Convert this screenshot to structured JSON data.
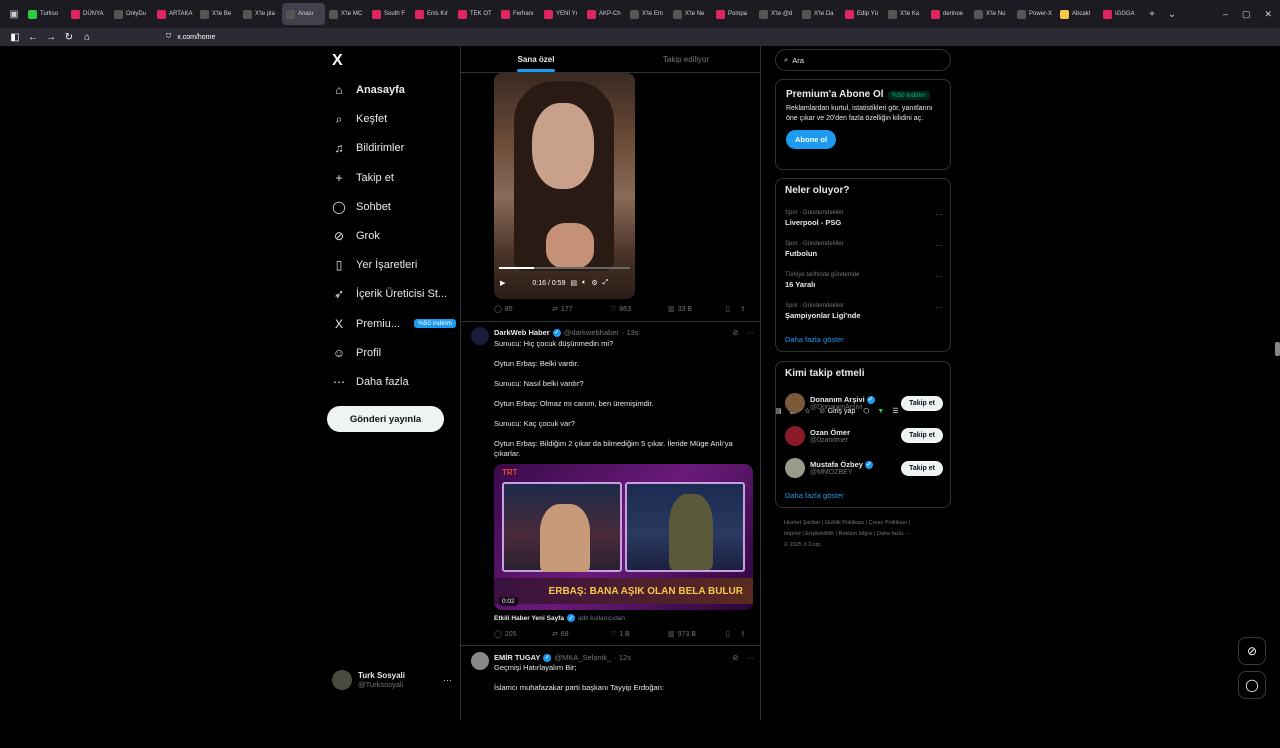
{
  "browser": {
    "tabs": [
      {
        "label": "Turkso",
        "color": "#2ecc40"
      },
      {
        "label": "DÜNYA",
        "color": "#e0245e"
      },
      {
        "label": "OnlyDu",
        "color": "#555"
      },
      {
        "label": "ARTAKA",
        "color": "#e0245e"
      },
      {
        "label": "X'te Be",
        "color": "#555"
      },
      {
        "label": "X'te pla",
        "color": "#555"
      },
      {
        "label": "Anası",
        "color": "#555"
      },
      {
        "label": "X'te MC",
        "color": "#555"
      },
      {
        "label": "South F",
        "color": "#e0245e"
      },
      {
        "label": "Enis Kır",
        "color": "#e0245e"
      },
      {
        "label": "TEK OT",
        "color": "#e0245e"
      },
      {
        "label": "Ferhanı",
        "color": "#e0245e"
      },
      {
        "label": "YENİ Yı",
        "color": "#e0245e"
      },
      {
        "label": "AKP-Ch",
        "color": "#e0245e"
      },
      {
        "label": "X'te Em",
        "color": "#555"
      },
      {
        "label": "X'te Ne",
        "color": "#555"
      },
      {
        "label": "Pompa",
        "color": "#e0245e"
      },
      {
        "label": "X'te @d",
        "color": "#555"
      },
      {
        "label": "X'te Da",
        "color": "#555"
      },
      {
        "label": "Edip Yü",
        "color": "#e0245e"
      },
      {
        "label": "X'te Ka",
        "color": "#555"
      },
      {
        "label": "derinoe",
        "color": "#e0245e"
      },
      {
        "label": "X'te Nu",
        "color": "#555"
      },
      {
        "label": "Power-X",
        "color": "#555"
      },
      {
        "label": "Abcakl",
        "color": "#f4c84a"
      },
      {
        "label": "IGGGA",
        "color": "#e0245e"
      }
    ],
    "active_tab_index": 6,
    "url": "x.com/home",
    "sign_in_label": "Giriş yap"
  },
  "nav": {
    "logo": "X",
    "items": [
      {
        "label": "Anasayfa",
        "icon": "home-icon",
        "glyph": "⌂"
      },
      {
        "label": "Keşfet",
        "icon": "search-icon",
        "glyph": "⌕"
      },
      {
        "label": "Bildirimler",
        "icon": "bell-icon",
        "glyph": "♫"
      },
      {
        "label": "Takip et",
        "icon": "follow-icon",
        "glyph": "+"
      },
      {
        "label": "Sohbet",
        "icon": "chat-icon",
        "glyph": "◯"
      },
      {
        "label": "Grok",
        "icon": "grok-icon",
        "glyph": "⊘"
      },
      {
        "label": "Yer İşaretleri",
        "icon": "bookmark-icon",
        "glyph": "▯"
      },
      {
        "label": "İçerik Üreticisi St...",
        "icon": "rocket-icon",
        "glyph": "➶"
      },
      {
        "label": "Premiu...",
        "icon": "x-premium-icon",
        "glyph": "X"
      },
      {
        "label": "Profil",
        "icon": "profile-icon",
        "glyph": "☺"
      },
      {
        "label": "Daha fazla",
        "icon": "more-icon",
        "glyph": "⋯"
      }
    ],
    "premium_badge": "%50 indirim",
    "post_button": "Gönderi yayınla",
    "account": {
      "name": "Turk Sosyali",
      "handle": "@Turksosyali"
    }
  },
  "main": {
    "tabs": [
      "Sana özel",
      "Takip ediliyor"
    ],
    "tweet1": {
      "video_time": "0:16 / 0:59",
      "progress": 0.27,
      "replies": "85",
      "retweets": "177",
      "likes": "863",
      "views": "33 B"
    },
    "tweet2": {
      "name": "DarkWeb Haber",
      "handle": "@darkwebhaber",
      "time": "· 13s",
      "lines": [
        "Sunucu: Hiç çocuk düşünmedin mi?",
        "Oytun Erbaş: Belki vardır.",
        "Sunucu: Nasıl belki vardır?",
        "Oytun Erbaş: Olmaz mı canım, ben üremişimdir.",
        "Sunucu: Kaç çocuk var?",
        "Oytun Erbaş: Bildiğim 2 çıkar da bilmediğim 5 çıkar. İleride Müge Anlı'ya",
        "çıkarlar."
      ],
      "media_caption": "ERBAŞ: BANA AŞIK OLAN BELA BULUR",
      "tv_logo": "TRT",
      "duration": "0:02",
      "source_name": "Etkili Haber Yeni Sayfa",
      "source_suffix": "adlı kullanıcıdan",
      "replies": "205",
      "retweets": "68",
      "likes": "1 B",
      "views": "973 B"
    },
    "tweet3": {
      "name": "EMİR TUGAY",
      "handle": "@MKA_Selanik_",
      "time": "· 12s",
      "lines": [
        "Geçmişi Hatırlayalım Bir;",
        "İslamcı muhafazakar parti başkanı Tayyip Erdoğan:"
      ]
    }
  },
  "right": {
    "search_placeholder": "Ara",
    "premium": {
      "title": "Premium'a Abone Ol",
      "badge": "%50 indirim",
      "text": "Reklamlardan kurtul, istatistikleri gör, yanıtlarını öne çıkar ve 20'den fazla özelliğin kilidini aç.",
      "button": "Abone ol"
    },
    "trends": {
      "title": "Neler oluyor?",
      "items": [
        {
          "category": "Spor · Gündemdekiler",
          "name": "Liverpool - PSG"
        },
        {
          "category": "Spor · Gündemdekiler",
          "name": "Futbolun"
        },
        {
          "category": "Türkiye tarihinde gündemde",
          "name": "16 Yaralı"
        },
        {
          "category": "Spor · Gündemdekiler",
          "name": "Şampiyonlar Ligi'nde"
        }
      ],
      "show_more": "Daha fazla göster"
    },
    "who_to_follow": {
      "title": "Kimi takip etmeli",
      "items": [
        {
          "name": "Donanım Arşivi",
          "handle": "@DonanimArsivi",
          "verified": true,
          "button": "Takip et",
          "color": "#7a5a3a"
        },
        {
          "name": "Ozan Ömer",
          "handle": "@0zanomer",
          "verified": false,
          "button": "Takip et",
          "color": "#8a1a2a"
        },
        {
          "name": "Mustafa Özbey",
          "handle": "@MMOZBEY",
          "verified": true,
          "button": "Takip et",
          "color": "#9a9a8a"
        }
      ],
      "show_more": "Daha fazla göster"
    },
    "footer": {
      "line1": "Hizmet Şartları  |  Gizlilik Politikası  |  Çerez Politikası  |",
      "line2": "Imprint  |  Erişilebilirlik  |  Reklam bilgisi  |  Daha fazla ···",
      "line3": "© 2025 X Corp."
    }
  }
}
